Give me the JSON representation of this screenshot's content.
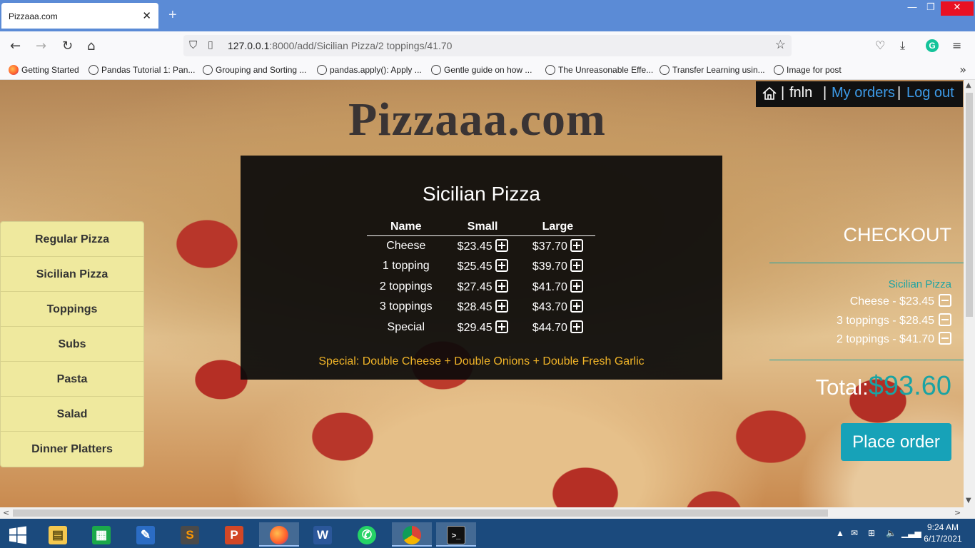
{
  "browser": {
    "tab_title": "Pizzaaa.com",
    "url_host": "127.0.0.1",
    "url_rest": ":8000/add/Sicilian Pizza/2 toppings/41.70",
    "bookmarks": [
      "Getting Started",
      "Pandas Tutorial 1: Pan...",
      "Grouping and Sorting ...",
      "pandas.apply(): Apply ...",
      "Gentle guide on how ...",
      "The Unreasonable Effe...",
      "Transfer Learning usin...",
      "Image for post"
    ]
  },
  "site": {
    "title": "Pizzaaa.com"
  },
  "user_nav": {
    "username": "fnln",
    "separator": "|",
    "my_orders": "My orders",
    "logout": "Log out"
  },
  "sidebar": {
    "items": [
      "Regular Pizza",
      "Sicilian Pizza",
      "Toppings",
      "Subs",
      "Pasta",
      "Salad",
      "Dinner Platters"
    ]
  },
  "menu": {
    "title": "Sicilian Pizza",
    "headers": [
      "Name",
      "Small",
      "Large"
    ],
    "rows": [
      {
        "name": "Cheese",
        "small": "$23.45",
        "large": "$37.70"
      },
      {
        "name": "1 topping",
        "small": "$25.45",
        "large": "$39.70"
      },
      {
        "name": "2 toppings",
        "small": "$27.45",
        "large": "$41.70"
      },
      {
        "name": "3 toppings",
        "small": "$28.45",
        "large": "$43.70"
      },
      {
        "name": "Special",
        "small": "$29.45",
        "large": "$44.70"
      }
    ],
    "special_note": "Special: Double Cheese + Double Onions + Double Fresh Garlic"
  },
  "checkout": {
    "title": "CHECKOUT",
    "group": "Sicilian Pizza",
    "items": [
      "Cheese - $23.45",
      "3 toppings - $28.45",
      "2 toppings - $41.70"
    ],
    "total_label": "Total:",
    "total_value": "$93.60",
    "place_order": "Place order"
  },
  "system": {
    "time": "9:24 AM",
    "date": "6/17/2021"
  }
}
